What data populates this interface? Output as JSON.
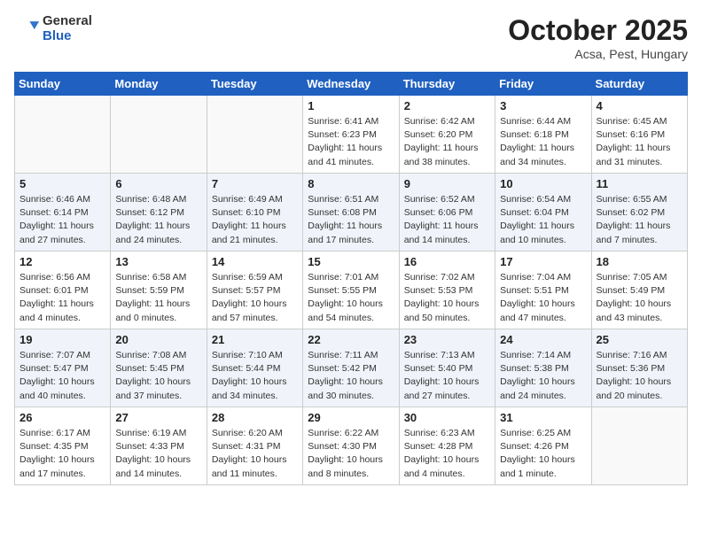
{
  "header": {
    "logo_general": "General",
    "logo_blue": "Blue",
    "month": "October 2025",
    "location": "Acsa, Pest, Hungary"
  },
  "days_of_week": [
    "Sunday",
    "Monday",
    "Tuesday",
    "Wednesday",
    "Thursday",
    "Friday",
    "Saturday"
  ],
  "weeks": [
    [
      {
        "day": "",
        "info": ""
      },
      {
        "day": "",
        "info": ""
      },
      {
        "day": "",
        "info": ""
      },
      {
        "day": "1",
        "info": "Sunrise: 6:41 AM\nSunset: 6:23 PM\nDaylight: 11 hours\nand 41 minutes."
      },
      {
        "day": "2",
        "info": "Sunrise: 6:42 AM\nSunset: 6:20 PM\nDaylight: 11 hours\nand 38 minutes."
      },
      {
        "day": "3",
        "info": "Sunrise: 6:44 AM\nSunset: 6:18 PM\nDaylight: 11 hours\nand 34 minutes."
      },
      {
        "day": "4",
        "info": "Sunrise: 6:45 AM\nSunset: 6:16 PM\nDaylight: 11 hours\nand 31 minutes."
      }
    ],
    [
      {
        "day": "5",
        "info": "Sunrise: 6:46 AM\nSunset: 6:14 PM\nDaylight: 11 hours\nand 27 minutes."
      },
      {
        "day": "6",
        "info": "Sunrise: 6:48 AM\nSunset: 6:12 PM\nDaylight: 11 hours\nand 24 minutes."
      },
      {
        "day": "7",
        "info": "Sunrise: 6:49 AM\nSunset: 6:10 PM\nDaylight: 11 hours\nand 21 minutes."
      },
      {
        "day": "8",
        "info": "Sunrise: 6:51 AM\nSunset: 6:08 PM\nDaylight: 11 hours\nand 17 minutes."
      },
      {
        "day": "9",
        "info": "Sunrise: 6:52 AM\nSunset: 6:06 PM\nDaylight: 11 hours\nand 14 minutes."
      },
      {
        "day": "10",
        "info": "Sunrise: 6:54 AM\nSunset: 6:04 PM\nDaylight: 11 hours\nand 10 minutes."
      },
      {
        "day": "11",
        "info": "Sunrise: 6:55 AM\nSunset: 6:02 PM\nDaylight: 11 hours\nand 7 minutes."
      }
    ],
    [
      {
        "day": "12",
        "info": "Sunrise: 6:56 AM\nSunset: 6:01 PM\nDaylight: 11 hours\nand 4 minutes."
      },
      {
        "day": "13",
        "info": "Sunrise: 6:58 AM\nSunset: 5:59 PM\nDaylight: 11 hours\nand 0 minutes."
      },
      {
        "day": "14",
        "info": "Sunrise: 6:59 AM\nSunset: 5:57 PM\nDaylight: 10 hours\nand 57 minutes."
      },
      {
        "day": "15",
        "info": "Sunrise: 7:01 AM\nSunset: 5:55 PM\nDaylight: 10 hours\nand 54 minutes."
      },
      {
        "day": "16",
        "info": "Sunrise: 7:02 AM\nSunset: 5:53 PM\nDaylight: 10 hours\nand 50 minutes."
      },
      {
        "day": "17",
        "info": "Sunrise: 7:04 AM\nSunset: 5:51 PM\nDaylight: 10 hours\nand 47 minutes."
      },
      {
        "day": "18",
        "info": "Sunrise: 7:05 AM\nSunset: 5:49 PM\nDaylight: 10 hours\nand 43 minutes."
      }
    ],
    [
      {
        "day": "19",
        "info": "Sunrise: 7:07 AM\nSunset: 5:47 PM\nDaylight: 10 hours\nand 40 minutes."
      },
      {
        "day": "20",
        "info": "Sunrise: 7:08 AM\nSunset: 5:45 PM\nDaylight: 10 hours\nand 37 minutes."
      },
      {
        "day": "21",
        "info": "Sunrise: 7:10 AM\nSunset: 5:44 PM\nDaylight: 10 hours\nand 34 minutes."
      },
      {
        "day": "22",
        "info": "Sunrise: 7:11 AM\nSunset: 5:42 PM\nDaylight: 10 hours\nand 30 minutes."
      },
      {
        "day": "23",
        "info": "Sunrise: 7:13 AM\nSunset: 5:40 PM\nDaylight: 10 hours\nand 27 minutes."
      },
      {
        "day": "24",
        "info": "Sunrise: 7:14 AM\nSunset: 5:38 PM\nDaylight: 10 hours\nand 24 minutes."
      },
      {
        "day": "25",
        "info": "Sunrise: 7:16 AM\nSunset: 5:36 PM\nDaylight: 10 hours\nand 20 minutes."
      }
    ],
    [
      {
        "day": "26",
        "info": "Sunrise: 6:17 AM\nSunset: 4:35 PM\nDaylight: 10 hours\nand 17 minutes."
      },
      {
        "day": "27",
        "info": "Sunrise: 6:19 AM\nSunset: 4:33 PM\nDaylight: 10 hours\nand 14 minutes."
      },
      {
        "day": "28",
        "info": "Sunrise: 6:20 AM\nSunset: 4:31 PM\nDaylight: 10 hours\nand 11 minutes."
      },
      {
        "day": "29",
        "info": "Sunrise: 6:22 AM\nSunset: 4:30 PM\nDaylight: 10 hours\nand 8 minutes."
      },
      {
        "day": "30",
        "info": "Sunrise: 6:23 AM\nSunset: 4:28 PM\nDaylight: 10 hours\nand 4 minutes."
      },
      {
        "day": "31",
        "info": "Sunrise: 6:25 AM\nSunset: 4:26 PM\nDaylight: 10 hours\nand 1 minute."
      },
      {
        "day": "",
        "info": ""
      }
    ]
  ]
}
